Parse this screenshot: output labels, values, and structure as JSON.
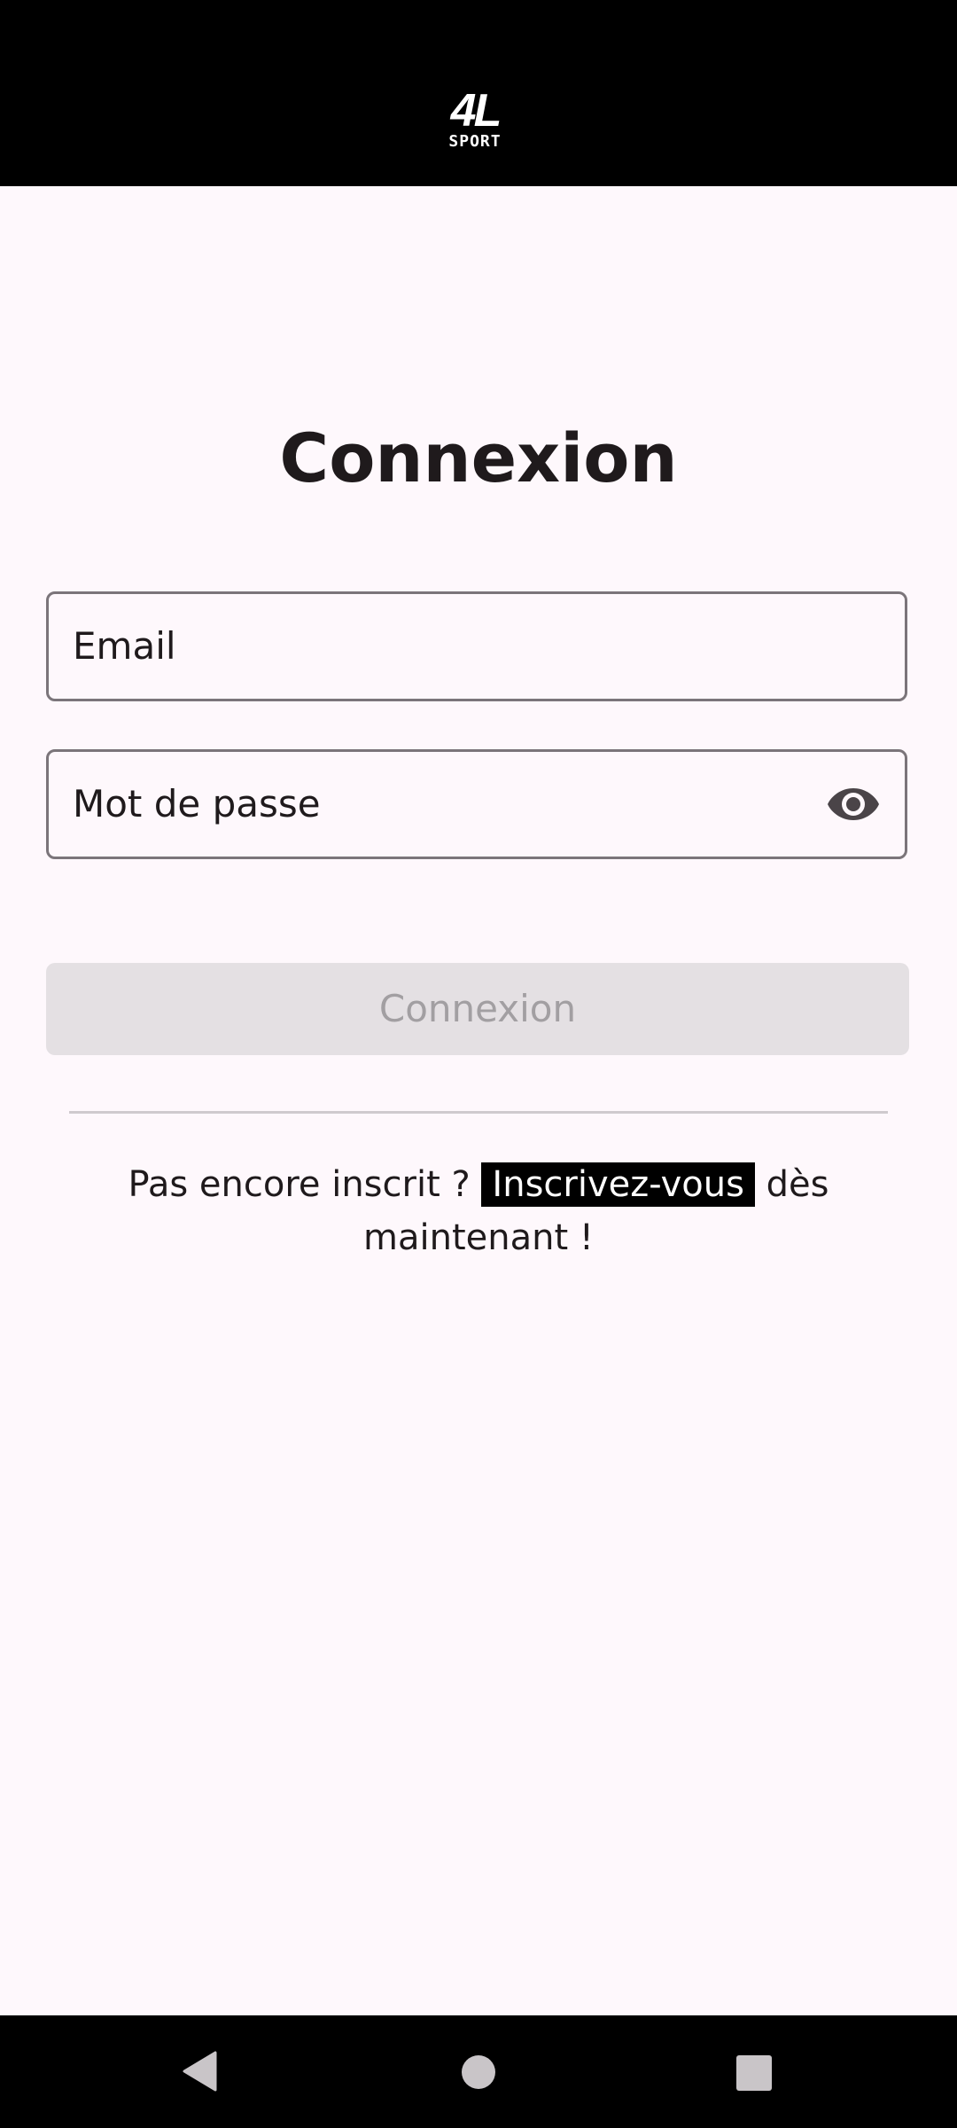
{
  "header": {
    "logo_mark": "4L",
    "logo_sub": "SPORT"
  },
  "login": {
    "title": "Connexion",
    "email_label": "Email",
    "password_label": "Mot de passe",
    "password_toggle_icon": "eye-icon",
    "submit_label": "Connexion"
  },
  "signup": {
    "prefix": "Pas encore inscrit ?",
    "link_label": "Inscrivez-vous",
    "suffix": "dès maintenant !"
  },
  "navigation": {
    "back_icon": "triangle-back-icon",
    "home_icon": "circle-home-icon",
    "recents_icon": "square-recents-icon"
  },
  "colors": {
    "background": "#FEF8FC",
    "app_bar": "#000000",
    "text": "#1F1A1C",
    "field_border": "#7B757A",
    "disabled_button": "#E4E0E3",
    "disabled_text": "#A29FA2",
    "link_background": "#000000",
    "link_text": "#FFFFFF"
  }
}
